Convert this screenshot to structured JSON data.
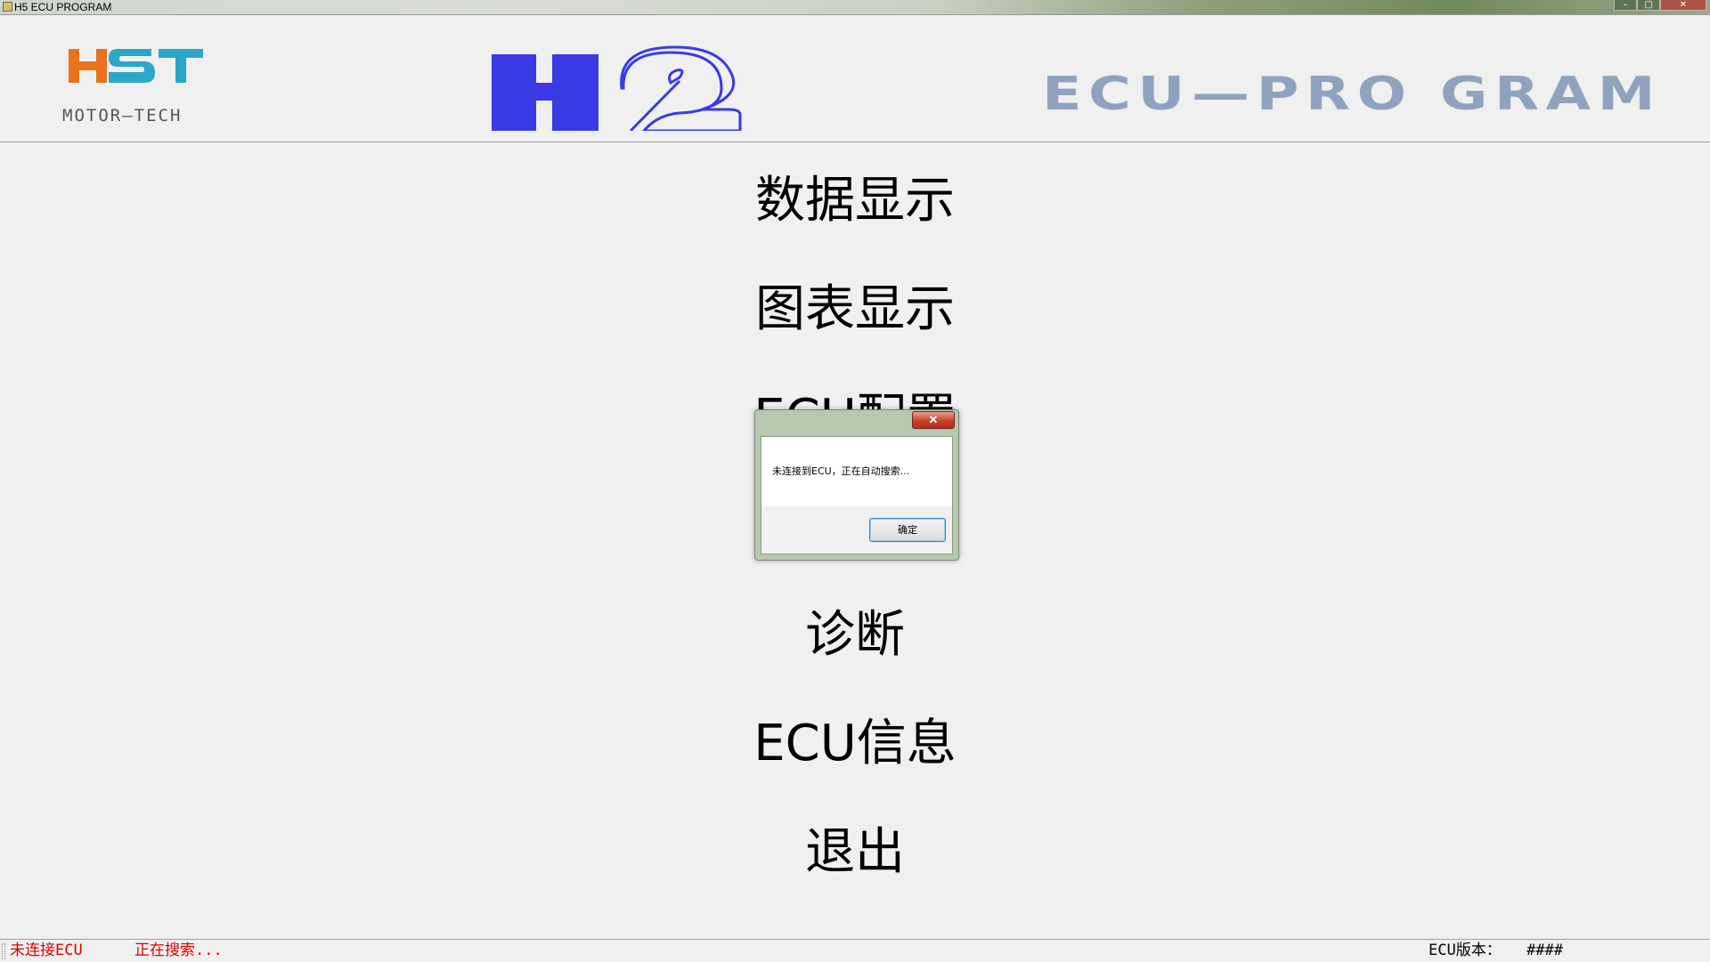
{
  "window": {
    "title": "H5 ECU PROGRAM",
    "minimize": "–",
    "maximize": "□",
    "close": "✕"
  },
  "header": {
    "hst_logo_text": "HST",
    "hst_logo_subtext": "MOTOR—TECH",
    "h2_logo_text": "H2",
    "ecu_program_text": "ECU—PRO GRAM"
  },
  "menu": {
    "items": [
      {
        "label": "数据显示"
      },
      {
        "label": "图表显示"
      },
      {
        "label": "ECU配置"
      },
      {
        "label": "诊断"
      },
      {
        "label": "ECU信息"
      },
      {
        "label": "退出"
      }
    ]
  },
  "dialog": {
    "close_label": "✕",
    "message": "未连接到ECU，正在自动搜索...",
    "ok_label": "确定"
  },
  "statusbar": {
    "connection": "未连接ECU",
    "search": "正在搜索...",
    "version_label": "ECU版本：",
    "version_value": "####"
  },
  "colors": {
    "hst_orange": "#e8721e",
    "hst_blue": "#2aa7c9",
    "h2_blue": "#3a3ae6",
    "ecu_gray_blue": "#8fa3bf",
    "status_red": "#e00000"
  }
}
